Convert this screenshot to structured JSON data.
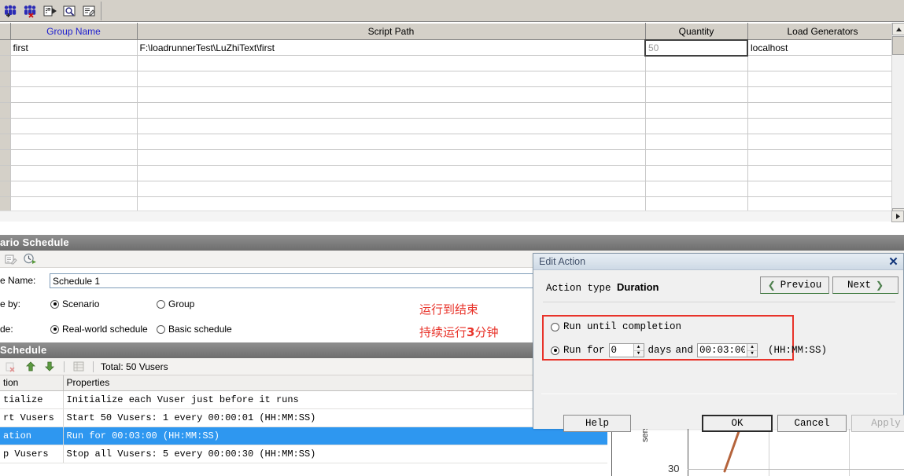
{
  "toolbar": {
    "buttons": [
      {
        "name": "add-vusers-icon",
        "label": "Add Vusers"
      },
      {
        "name": "remove-vusers-icon",
        "label": "Remove Vusers"
      },
      {
        "name": "run-script-icon",
        "label": "Run Script"
      },
      {
        "name": "view-script-icon",
        "label": "View Script"
      },
      {
        "name": "edit-script-icon",
        "label": "Edit Script"
      }
    ]
  },
  "grid": {
    "columns": [
      "Group Name",
      "Script Path",
      "Quantity",
      "Load Generators"
    ],
    "rows": [
      {
        "group_name": "first",
        "script_path": "F:\\loadrunnerTest\\LuZhiText\\first",
        "quantity": "50",
        "load_generators": "localhost"
      }
    ],
    "empty_row_count": 10
  },
  "scenario_schedule": {
    "panel_title": "ario Schedule",
    "toolbar_icons": [
      "edit-schedule-icon",
      "clock-icon"
    ],
    "schedule_name_label": "e Name:",
    "schedule_name_value": "Schedule 1",
    "schedule_by_label": "e by:",
    "schedule_by_options": [
      "Scenario",
      "Group"
    ],
    "schedule_by_selected": "Scenario",
    "run_mode_label": "de:",
    "run_mode_options": [
      "Real-world schedule",
      "Basic schedule"
    ],
    "run_mode_selected": "Real-world schedule"
  },
  "global_schedule": {
    "panel_title": "Schedule",
    "total_label": "Total: 50 Vusers",
    "columns": [
      "tion",
      "Properties"
    ],
    "rows": [
      {
        "action": "tialize",
        "properties": "Initialize each Vuser just before it runs",
        "selected": false
      },
      {
        "action": "rt  Vusers",
        "properties": "Start 50 Vusers: 1 every 00:00:01 (HH:MM:SS)",
        "selected": false
      },
      {
        "action": "ation",
        "properties": "Run for 00:03:00 (HH:MM:SS)",
        "selected": true
      },
      {
        "action": "p Vusers",
        "properties": "Stop all Vusers: 5 every 00:00:30 (HH:MM:SS)",
        "selected": false
      }
    ]
  },
  "annotation": {
    "line1": "运行到结束",
    "line2_a": "持续运行",
    "line2_b": "3",
    "line2_c": "分钟",
    "color": "#e8332a"
  },
  "edit_action_dialog": {
    "title": "Edit Action",
    "close_label": "✕",
    "action_type_label": "Action type",
    "action_type_value": "Duration",
    "previous_label": "Previou",
    "next_label": "Next",
    "option_until_completion": "Run until completion",
    "option_run_for_prefix": "Run for",
    "days_value": "0",
    "days_label": "days",
    "and_label": "and",
    "duration_value": "00:03:00",
    "time_format_hint": "(HH:MM:SS)",
    "selected_option": "run_for",
    "buttons": {
      "help": "Help",
      "ok": "OK",
      "cancel": "Cancel",
      "apply": "Apply"
    },
    "highlight_color": "#e8332a"
  },
  "background_chart": {
    "ylabel": "sers",
    "ytick": "30",
    "series_color": "#b5643c"
  }
}
